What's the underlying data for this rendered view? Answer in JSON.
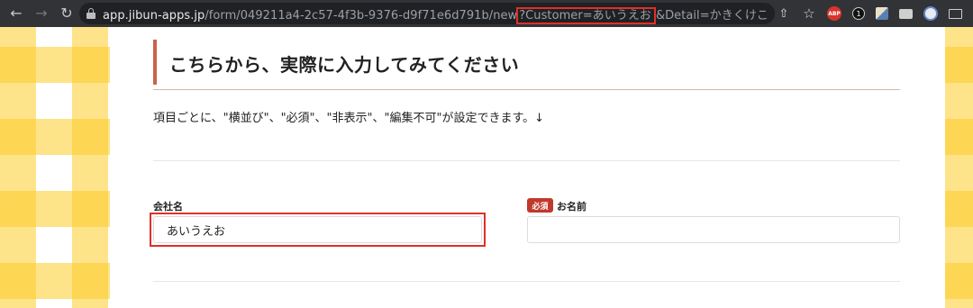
{
  "browser": {
    "url_host": "app.jibun-apps.jp",
    "url_path": "/form/049211a4-2c57-4f3b-9376-d9f71e6d791b/new",
    "url_query_highlighted": "?Customer=あいうえお",
    "url_query_rest": "&Detail=かきくけこ",
    "back_icon": "←",
    "forward_icon": "→",
    "reload_icon": "↻",
    "share_icon": "⇧",
    "star_icon": "☆",
    "abp_label": "ABP",
    "one_label": "1"
  },
  "form": {
    "heading": "こちらから、実際に入力してみてください",
    "description": "項目ごとに、\"横並び\"、\"必須\"、\"非表示\"、\"編集不可\"が設定できます。↓",
    "fields": [
      {
        "label": "会社名",
        "value": "あいうえお",
        "required": false
      },
      {
        "label": "お名前",
        "value": "",
        "required": true,
        "required_badge": "必須"
      }
    ]
  },
  "colors": {
    "accent": "#c8644b",
    "highlight": "#e0302a",
    "badge": "#c0392b",
    "plaid": "#fccc28"
  }
}
